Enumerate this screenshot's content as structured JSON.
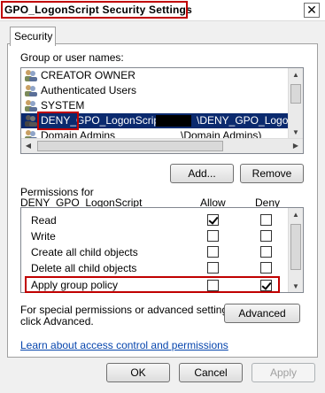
{
  "window": {
    "title": "GPO_LogonScript Security Settings",
    "close_glyph": "✕"
  },
  "tabs": [
    {
      "label": "Security"
    }
  ],
  "groups": {
    "label": "Group or user names:",
    "items": [
      {
        "name": "CREATOR OWNER",
        "icon": "users-icon"
      },
      {
        "name": "Authenticated Users",
        "icon": "users-icon"
      },
      {
        "name": "SYSTEM",
        "icon": "users-icon"
      },
      {
        "name": "DENY_GPO_LogonScript",
        "suffix": "\\DENY_GPO_LogonS",
        "icon": "users-icon",
        "selected": true
      },
      {
        "name": "Domain Admins",
        "suffix": "\\Domain Admins)",
        "icon": "users-icon"
      }
    ]
  },
  "buttons": {
    "add": "Add...",
    "remove": "Remove",
    "advanced": "Advanced",
    "ok": "OK",
    "cancel": "Cancel",
    "apply": "Apply"
  },
  "permissions": {
    "label_line1": "Permissions for",
    "label_line2": "DENY_GPO_LogonScript",
    "allow_header": "Allow",
    "deny_header": "Deny",
    "rows": [
      {
        "name": "Read",
        "allow": true,
        "deny": false
      },
      {
        "name": "Write",
        "allow": false,
        "deny": false
      },
      {
        "name": "Create all child objects",
        "allow": false,
        "deny": false
      },
      {
        "name": "Delete all child objects",
        "allow": false,
        "deny": false
      },
      {
        "name": "Apply group policy",
        "allow": false,
        "deny": true
      }
    ]
  },
  "special_text_line1": "For special permissions or advanced settings,",
  "special_text_line2": "click Advanced.",
  "learn_link": "Learn about access control and permissions",
  "colors": {
    "highlight": "#c00000",
    "selection": "#0b2a6e",
    "link": "#0645ad"
  }
}
